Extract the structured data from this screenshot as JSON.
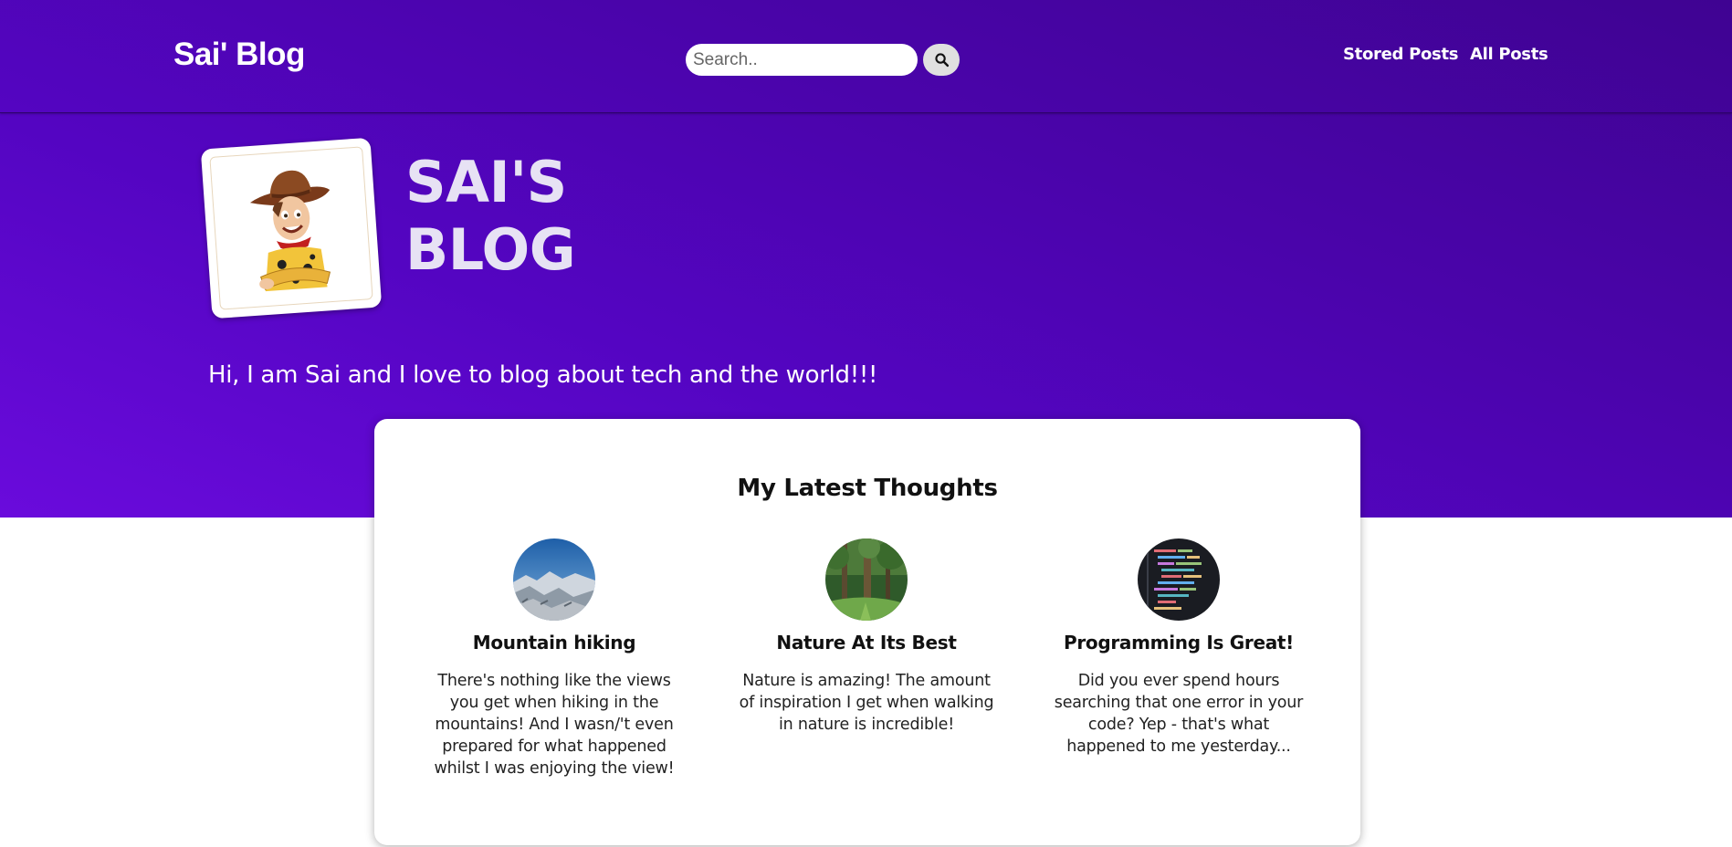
{
  "header": {
    "brand": "Sai' Blog",
    "search": {
      "placeholder": "Search..",
      "value": ""
    },
    "nav": [
      {
        "label": "Stored Posts"
      },
      {
        "label": "All Posts"
      }
    ]
  },
  "hero": {
    "title_line1": "SAI'S",
    "title_line2": "BLOG",
    "intro": "Hi, I am Sai and I love to blog about tech and the world!!!",
    "avatar_icon": "cowboy-character-icon"
  },
  "latest": {
    "title": "My Latest Thoughts",
    "posts": [
      {
        "title": "Mountain hiking",
        "body": "There's nothing like the views you get when hiking in the mountains! And I wasn/'t even prepared for what happened whilst I was enjoying the view!",
        "thumb_icon": "mountain-image"
      },
      {
        "title": "Nature At Its Best",
        "body": "Nature is amazing! The amount of inspiration I get when walking in nature is incredible!",
        "thumb_icon": "forest-image"
      },
      {
        "title": "Programming Is Great!",
        "body": "Did you ever spend hours searching that one error in your code? Yep - that's what happened to me yesterday...",
        "thumb_icon": "code-image"
      }
    ]
  },
  "colors": {
    "hero_gradient_start": "#6a0bdc",
    "hero_gradient_end": "#3f0392",
    "title_text": "#e7e2f4",
    "card_bg": "#ffffff"
  }
}
